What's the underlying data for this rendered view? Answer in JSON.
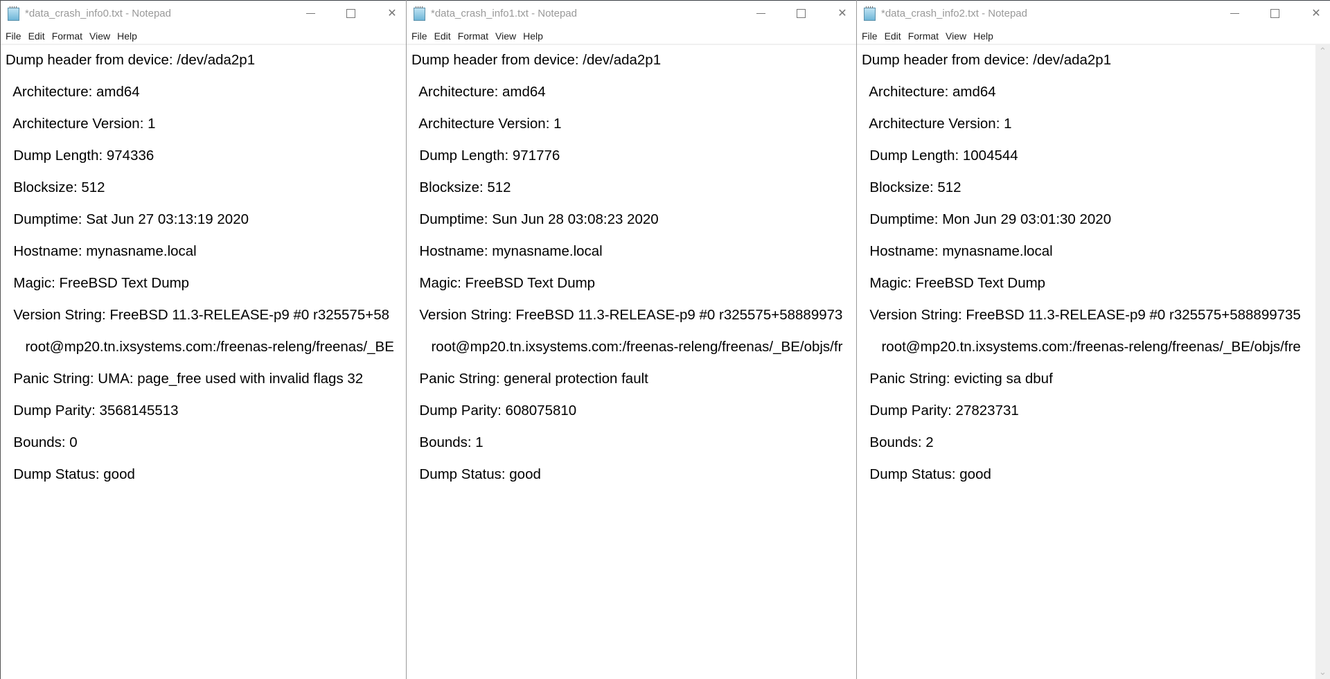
{
  "windows": [
    {
      "title": "*data_crash_info0.txt - Notepad",
      "menu": [
        "File",
        "Edit",
        "Format",
        "View",
        "Help"
      ],
      "lines": [
        "Dump header from device: /dev/ada2p1",
        "  Architecture: amd64",
        "  Architecture Version: 1",
        "  Dump Length: 974336",
        "  Blocksize: 512",
        "  Dumptime: Sat Jun 27 03:13:19 2020",
        "  Hostname: mynasname.local",
        "  Magic: FreeBSD Text Dump",
        "  Version String: FreeBSD 11.3-RELEASE-p9 #0 r325575+58",
        "     root@mp20.tn.ixsystems.com:/freenas-releng/freenas/_BE",
        "  Panic String: UMA: page_free used with invalid flags 32",
        "  Dump Parity: 3568145513",
        "  Bounds: 0",
        "  Dump Status: good"
      ]
    },
    {
      "title": "*data_crash_info1.txt - Notepad",
      "menu": [
        "File",
        "Edit",
        "Format",
        "View",
        "Help"
      ],
      "lines": [
        "Dump header from device: /dev/ada2p1",
        "  Architecture: amd64",
        "  Architecture Version: 1",
        "  Dump Length: 971776",
        "  Blocksize: 512",
        "  Dumptime: Sun Jun 28 03:08:23 2020",
        "  Hostname: mynasname.local",
        "  Magic: FreeBSD Text Dump",
        "  Version String: FreeBSD 11.3-RELEASE-p9 #0 r325575+58889973",
        "     root@mp20.tn.ixsystems.com:/freenas-releng/freenas/_BE/objs/fr",
        "  Panic String: general protection fault",
        "  Dump Parity: 608075810",
        "  Bounds: 1",
        "  Dump Status: good"
      ]
    },
    {
      "title": "*data_crash_info2.txt - Notepad",
      "menu": [
        "File",
        "Edit",
        "Format",
        "View",
        "Help"
      ],
      "lines": [
        "Dump header from device: /dev/ada2p1",
        "  Architecture: amd64",
        "  Architecture Version: 1",
        "  Dump Length: 1004544",
        "  Blocksize: 512",
        "  Dumptime: Mon Jun 29 03:01:30 2020",
        "  Hostname: mynasname.local",
        "  Magic: FreeBSD Text Dump",
        "  Version String: FreeBSD 11.3-RELEASE-p9 #0 r325575+588899735",
        "     root@mp20.tn.ixsystems.com:/freenas-releng/freenas/_BE/objs/fre",
        "  Panic String: evicting sa dbuf",
        "  Dump Parity: 27823731",
        "  Bounds: 2",
        "  Dump Status: good"
      ]
    }
  ]
}
